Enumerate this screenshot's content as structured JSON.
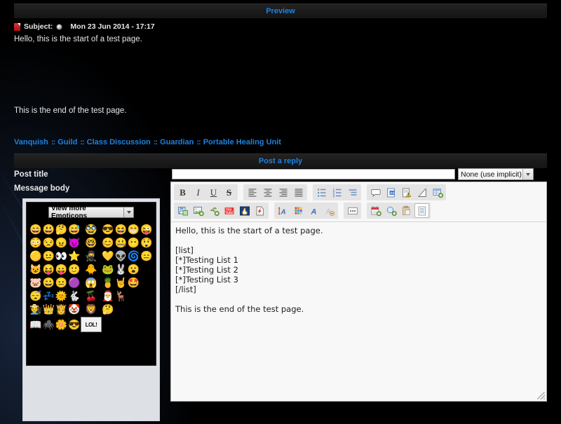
{
  "preview": {
    "bar_label": "Preview",
    "subject_label": "Subject:",
    "subject_icon": "red-document-icon",
    "date_icon": "clock-icon",
    "date": "Mon 23 Jun 2014 - 17:17",
    "body_line_1": "Hello, this is the start of a test page.",
    "body_line_2": "This is the end of the test page."
  },
  "breadcrumb": {
    "separator": "::",
    "items": [
      {
        "label": "Vanquish"
      },
      {
        "label": "Guild"
      },
      {
        "label": "Class Discussion"
      },
      {
        "label": "Guardian"
      },
      {
        "label": "Portable Healing Unit"
      }
    ]
  },
  "reply": {
    "bar_label": "Post a reply",
    "post_title_label": "Post title",
    "message_body_label": "Message body",
    "title_value": "",
    "title_placeholder": "",
    "icon_select_value": "None (use implicit)"
  },
  "emoticons": {
    "select_label": "View more Emoticons",
    "rows": [
      [
        "😄",
        "😃",
        "🤔",
        "😅",
        "🥸",
        "😎",
        "😆",
        "😁",
        "😜"
      ],
      [
        "😳",
        "😒",
        "😠",
        "😈",
        "🤓",
        "😊",
        "🤐",
        "😶",
        "😲"
      ],
      [
        "🟡",
        "😐",
        "👀",
        "⭐",
        "🥷",
        "💛",
        "👽",
        "🌀",
        "😑"
      ],
      [
        "😺",
        "😝",
        "😛",
        "🙂",
        "🐥",
        "🐸",
        "🐰",
        "😮",
        " "
      ],
      [
        "🐷",
        "😀",
        "😐",
        "🟣",
        "😱",
        "🍍",
        "🤘",
        "🤩",
        " "
      ],
      [
        "😴",
        "💤",
        "🌞",
        "🐇",
        "🍒",
        "🎅",
        "🦌",
        " ",
        " "
      ],
      [
        "🧑‍🌾",
        "👑",
        "👸",
        "🤡",
        "🦁",
        "🤔",
        " ",
        " ",
        " "
      ],
      [
        "📖",
        "🕷️",
        "🌼",
        "😎",
        "LOL!",
        " ",
        " ",
        " ",
        " "
      ]
    ]
  },
  "toolbar": {
    "row1": [
      {
        "group": "text-style",
        "buttons": [
          {
            "name": "bold-button",
            "glyph": "B",
            "style": "bold"
          },
          {
            "name": "italic-button",
            "glyph": "I",
            "style": "italic"
          },
          {
            "name": "underline-button",
            "glyph": "U",
            "style": "underline"
          },
          {
            "name": "strikethrough-button",
            "glyph": "S",
            "style": "strike"
          }
        ]
      },
      {
        "group": "alignment",
        "buttons": [
          {
            "name": "align-left-button",
            "glyph": "align-left-icon"
          },
          {
            "name": "align-center-button",
            "glyph": "align-center-icon"
          },
          {
            "name": "align-right-button",
            "glyph": "align-right-icon"
          },
          {
            "name": "align-justify-button",
            "glyph": "align-justify-icon"
          }
        ]
      },
      {
        "group": "lists",
        "buttons": [
          {
            "name": "bullet-list-button",
            "glyph": "bullet-list-icon"
          },
          {
            "name": "numbered-list-button",
            "glyph": "numbered-list-icon"
          },
          {
            "name": "indent-button",
            "glyph": "indent-icon"
          }
        ]
      },
      {
        "group": "insert-block",
        "buttons": [
          {
            "name": "quote-button",
            "glyph": "speech-bubble-icon"
          },
          {
            "name": "code-button",
            "glyph": "code-page-icon"
          },
          {
            "name": "spoiler-button",
            "glyph": "warning-page-icon"
          },
          {
            "name": "hidden-button",
            "glyph": "blank-page-icon"
          },
          {
            "name": "table-button",
            "glyph": "table-add-icon"
          }
        ]
      }
    ],
    "row2": [
      {
        "group": "media",
        "buttons": [
          {
            "name": "save-button",
            "glyph": "floppy-image-icon"
          },
          {
            "name": "insert-image-button",
            "glyph": "image-add-icon"
          },
          {
            "name": "insert-link-button",
            "glyph": "link-add-icon"
          },
          {
            "name": "youtube-button",
            "glyph": "youtube-icon"
          },
          {
            "name": "flame-button",
            "glyph": "flame-icon"
          },
          {
            "name": "flash-button",
            "glyph": "flash-page-icon"
          }
        ]
      },
      {
        "group": "font",
        "buttons": [
          {
            "name": "font-size-button",
            "glyph": "font-size-icon"
          },
          {
            "name": "font-color-button",
            "glyph": "color-palette-icon"
          },
          {
            "name": "font-family-button",
            "glyph": "font-family-icon"
          },
          {
            "name": "remove-format-button",
            "glyph": "clear-format-icon"
          }
        ]
      },
      {
        "group": "more",
        "buttons": [
          {
            "name": "more-options-button",
            "glyph": "ellipsis-icon"
          }
        ]
      },
      {
        "group": "extras",
        "buttons": [
          {
            "name": "calendar-button",
            "glyph": "calendar-add-icon"
          },
          {
            "name": "preview-button",
            "glyph": "search-add-icon"
          },
          {
            "name": "paste-button",
            "glyph": "clipboard-icon"
          },
          {
            "name": "page-button",
            "glyph": "document-icon",
            "active": true
          }
        ]
      }
    ]
  },
  "message": {
    "value": "Hello, this is the start of a test page.\n\n[list]\n[*]Testing List 1\n[*]Testing List 2\n[*]Testing List 3\n[/list]\n\nThis is the end of the test page."
  },
  "colors": {
    "link": "#1c82e2",
    "bar_bg": "#1b1b1b",
    "page_bg": "#000000",
    "editor_bg": "#f7f7f7",
    "panel_bg": "#dde1e6"
  }
}
